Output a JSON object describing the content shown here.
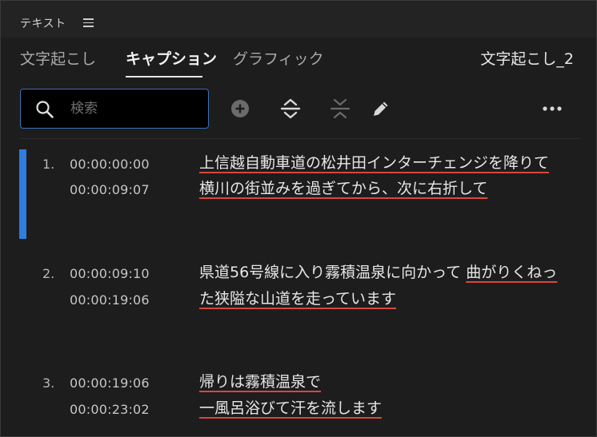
{
  "panel": {
    "title": "テキスト",
    "doc_name": "文字起こし_2"
  },
  "tabs": [
    {
      "label": "文字起こし",
      "active": false
    },
    {
      "label": "キャプション",
      "active": true
    },
    {
      "label": "グラフィック",
      "active": false
    }
  ],
  "search": {
    "placeholder": "検索",
    "value": ""
  },
  "toolbar": {
    "icons": [
      "add-caption-icon",
      "merge-captions-icon",
      "split-caption-icon",
      "edit-icon",
      "more-options-icon"
    ]
  },
  "captions": [
    {
      "number": "1.",
      "start": "00:00:00:00",
      "end": "00:00:09:07",
      "line1": "上信越自動車道の松井田インターチェンジを降りて",
      "line2": "横川の街並みを過ぎてから、次に右折して",
      "selected": true
    },
    {
      "number": "2.",
      "start": "00:00:09:10",
      "end": "00:00:19:06",
      "line1_plain": "県道56号線に入り霧積温泉に向かって ",
      "line1_underlined": "曲がりくねっ",
      "line2": "た狭隘な山道を走っています",
      "selected": false
    },
    {
      "number": "3.",
      "start": "00:00:19:06",
      "end": "00:00:23:02",
      "line1": "帰りは霧積温泉で",
      "line2": "一風呂浴びて汗を流します",
      "selected": false
    }
  ],
  "colors": {
    "accent_blue": "#2f7de1",
    "underline_red": "#d9473c",
    "search_border": "#3b6fb6"
  }
}
